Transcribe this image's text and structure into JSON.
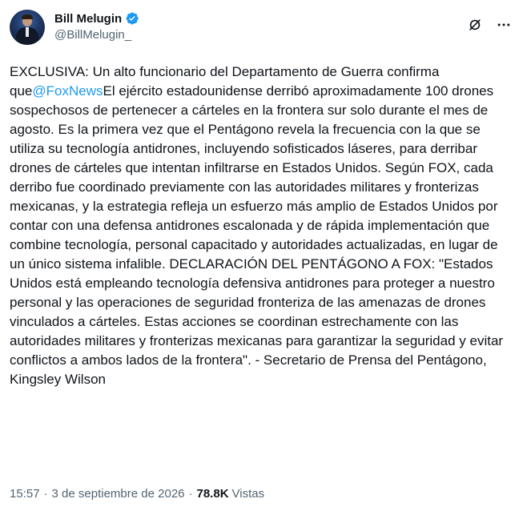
{
  "author": {
    "display_name": "Bill Melugin",
    "handle": "@BillMelugin_",
    "verified": true,
    "verified_color": "#1d9bf0"
  },
  "header_actions": {
    "grok_icon": "grok-icon",
    "more_icon": "more-icon"
  },
  "post": {
    "text_before": "EXCLUSIVA: Un alto funcionario del Departamento de Guerra confirma que",
    "mention": "@FoxNews",
    "text_after": "El ejército estadounidense derribó aproximadamente 100 drones sospechosos de pertenecer a cárteles en la frontera sur solo durante el mes de agosto. Es la primera vez que el Pentágono revela la frecuencia con la que se utiliza su tecnología antidrones, incluyendo sofisticados láseres, para derribar drones de cárteles que intentan infiltrarse en Estados Unidos. Según FOX, cada derribo fue coordinado previamente con las autoridades militares y fronterizas mexicanas, y la estrategia refleja un esfuerzo más amplio de Estados Unidos por contar con una defensa antidrones escalonada y de rápida implementación que combine tecnología, personal capacitado y autoridades actualizadas, en lugar de un único sistema infalible. DECLARACIÓN DEL PENTÁGONO A FOX: \"Estados Unidos está empleando tecnología defensiva antidrones para proteger a nuestro personal y las operaciones de seguridad fronteriza de las amenazas de drones vinculados a cárteles. Estas acciones se coordinan estrechamente con las autoridades militares y fronterizas mexicanas para garantizar la seguridad y evitar conflictos a ambos lados de la frontera\". - Secretario de Prensa del Pentágono, Kingsley Wilson"
  },
  "meta": {
    "time": "15:57",
    "separator": "·",
    "date": "3 de septiembre de 2026",
    "views_count": "78.8K",
    "views_label": "Vistas"
  }
}
